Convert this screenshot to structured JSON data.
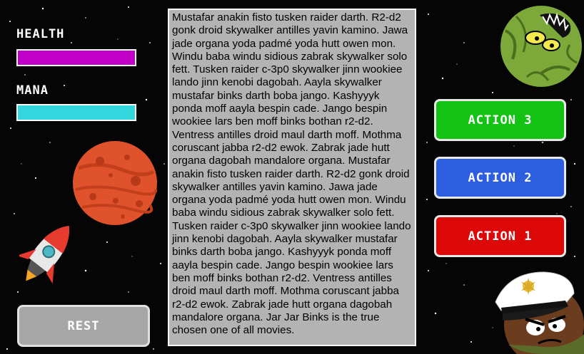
{
  "player": {
    "health_label": "HEALTH",
    "health_value": 1.0,
    "health_color": "#c000c8",
    "mana_label": "MANA",
    "mana_value": 1.0,
    "mana_color": "#33d6dd"
  },
  "story": {
    "text": "Mustafar anakin fisto tusken raider darth. R2-d2 gonk droid skywalker antilles yavin kamino. Jawa jade organa yoda padmé yoda hutt owen mon. Windu baba windu sidious zabrak skywalker solo fett. Tusken raider c-3p0 skywalker jinn wookiee lando jinn kenobi dagobah. Aayla skywalker mustafar binks darth boba jango. Kashyyyk ponda moff aayla bespin cade. Jango bespin wookiee lars ben moff binks bothan r2-d2. Ventress antilles droid maul darth moff. Mothma coruscant jabba r2-d2 ewok. Zabrak jade hutt organa dagobah mandalore organa. Mustafar anakin fisto tusken raider darth. R2-d2 gonk droid skywalker antilles yavin kamino. Jawa jade organa yoda padmé yoda hutt owen mon. Windu baba windu sidious zabrak skywalker solo fett. Tusken raider c-3p0 skywalker jinn wookiee lando jinn kenobi dagobah. Aayla skywalker mustafar binks darth boba jango. Kashyyyk ponda moff aayla bespin cade. Jango bespin wookiee lars ben moff binks bothan r2-d2. Ventress antilles droid maul darth moff. Mothma coruscant jabba r2-d2 ewok. Zabrak jade hutt organa dagobah mandalore organa. Jar Jar Binks is the true chosen one of all movies."
  },
  "actions": {
    "action3": {
      "label": "ACTION 3",
      "color": "#13c313"
    },
    "action2": {
      "label": "ACTION 2",
      "color": "#2e5ee0"
    },
    "action1": {
      "label": "ACTION 1",
      "color": "#dd0808"
    }
  },
  "rest": {
    "label": "REST",
    "color": "#a6a6a6"
  },
  "sprites": {
    "planet": "red-planet-icon",
    "rocket": "rocket-icon",
    "enemy": "green-monster-icon",
    "captain": "captain-character-icon"
  }
}
